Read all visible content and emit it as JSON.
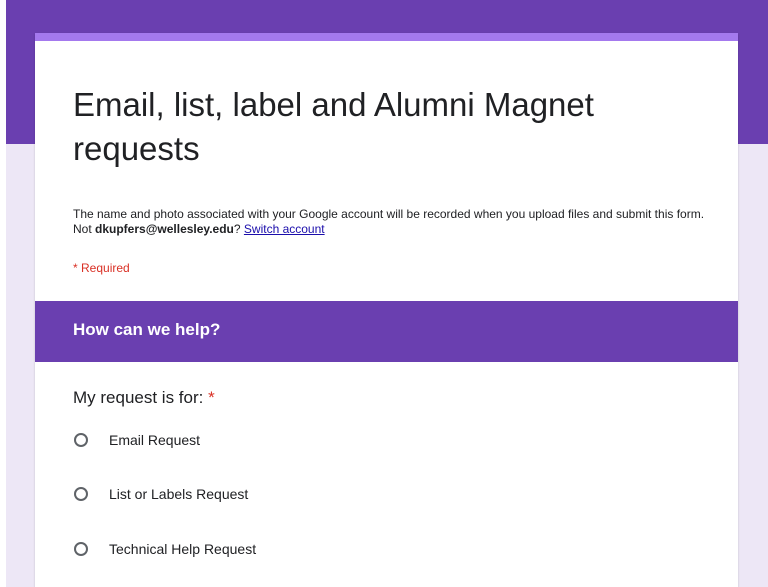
{
  "form": {
    "title": "Email, list, label and Alumni Magnet requests",
    "notice_text": "The name and photo associated with your Google account will be recorded when you upload files and submit this form. Not ",
    "account_email": "dkupfers@wellesley.edu",
    "notice_after": "? ",
    "switch_account": "Switch account",
    "required_note": "* Required"
  },
  "section": {
    "title": "How can we help?"
  },
  "question": {
    "label": "My request is for: ",
    "required_marker": "*",
    "options": [
      {
        "label": "Email Request"
      },
      {
        "label": "List or Labels Request"
      },
      {
        "label": "Technical Help Request"
      }
    ]
  },
  "colors": {
    "theme": "#6a3fb0",
    "accent": "#a479ee",
    "background": "#ede7f6",
    "required": "#d93025",
    "link": "#1a0dab"
  }
}
